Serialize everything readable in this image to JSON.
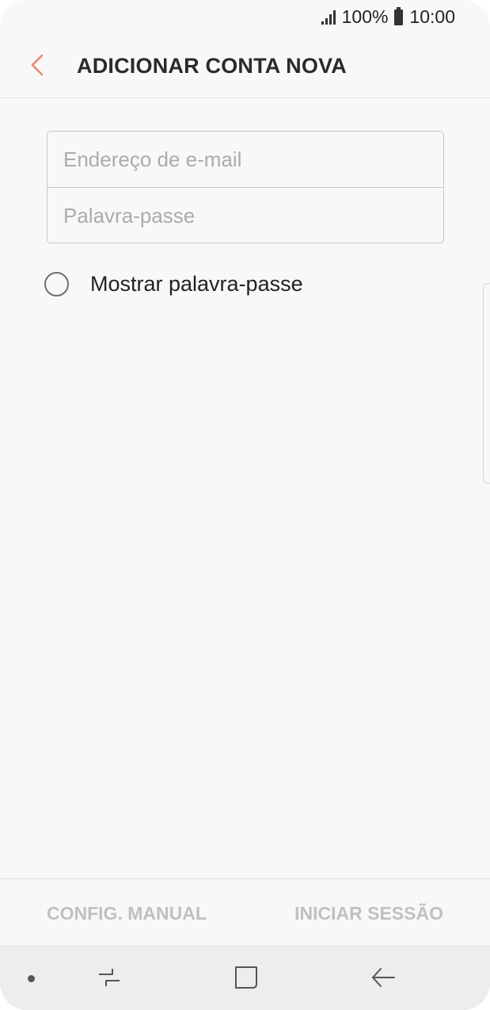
{
  "status_bar": {
    "battery_percent": "100%",
    "time": "10:00",
    "signal_icon": "signal-icon",
    "battery_icon": "battery-icon"
  },
  "app_bar": {
    "title": "ADICIONAR CONTA NOVA",
    "back_icon": "chevron-left-icon",
    "accent_color": "#e8896a"
  },
  "form": {
    "email": {
      "placeholder": "Endereço de e-mail",
      "value": ""
    },
    "password": {
      "placeholder": "Palavra-passe",
      "value": ""
    }
  },
  "show_password": {
    "label": "Mostrar palavra-passe",
    "checked": false
  },
  "bottom_buttons": {
    "manual_label": "CONFIG. MANUAL",
    "signin_label": "INICIAR SESSÃO"
  },
  "nav_bar": {
    "icons": [
      "dot-icon",
      "recents-icon",
      "home-icon",
      "back-arrow-icon"
    ]
  }
}
